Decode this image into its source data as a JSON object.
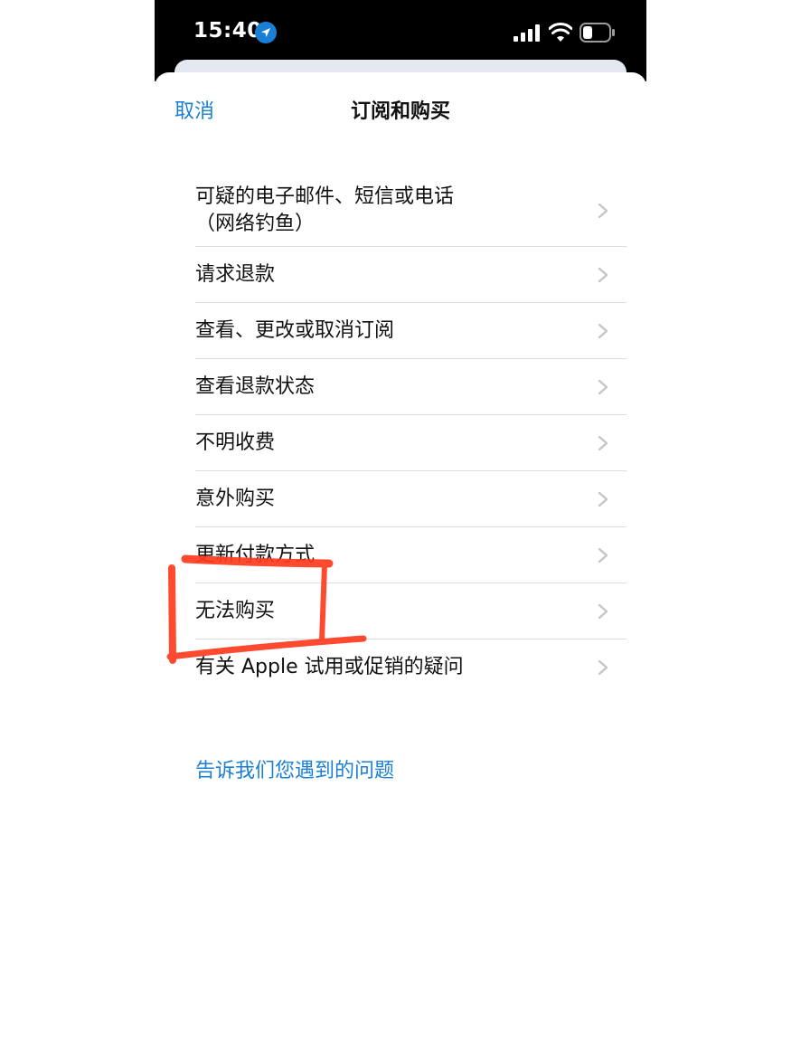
{
  "status_bar": {
    "time": "15:40",
    "icons": [
      "location-arrow-icon",
      "cellular-signal-icon",
      "wifi-icon",
      "battery-icon"
    ]
  },
  "nav": {
    "cancel_label": "取消",
    "title": "订阅和购买"
  },
  "list": {
    "items": [
      {
        "label": "可疑的电子邮件、短信或电话\n（网络钓鱼）"
      },
      {
        "label": "请求退款"
      },
      {
        "label": "查看、更改或取消订阅"
      },
      {
        "label": "查看退款状态"
      },
      {
        "label": "不明收费"
      },
      {
        "label": "意外购买"
      },
      {
        "label": "更新付款方式"
      },
      {
        "label": "无法购买"
      },
      {
        "label": "有关 Apple 试用或促销的疑问"
      }
    ]
  },
  "footer": {
    "link_label": "告诉我们您遇到的问题"
  },
  "colors": {
    "accent": "#1a7fd4",
    "annotation": "#ff3b1f",
    "status_bar": "#000000"
  }
}
